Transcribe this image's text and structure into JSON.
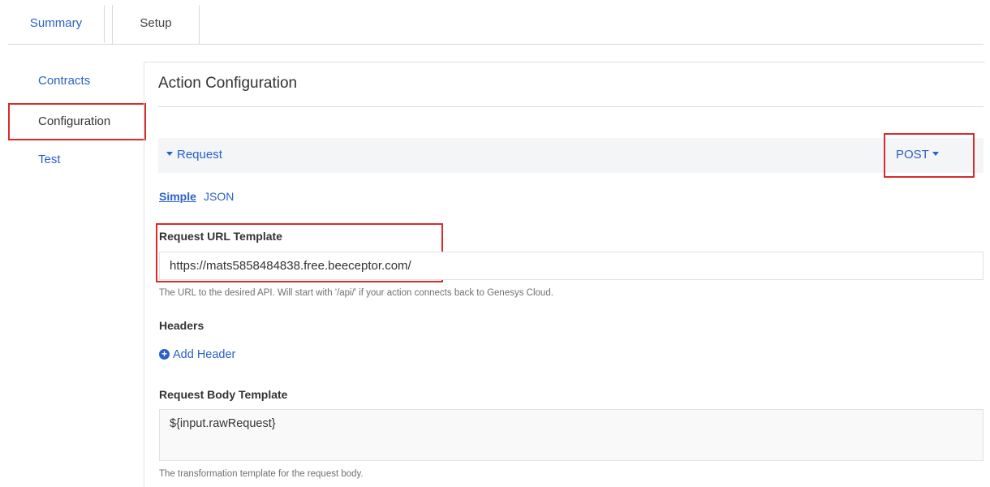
{
  "tabs": [
    {
      "label": "Summary"
    },
    {
      "label": "Setup"
    }
  ],
  "sidebar": {
    "items": [
      {
        "label": "Contracts"
      },
      {
        "label": "Configuration"
      },
      {
        "label": "Test"
      }
    ]
  },
  "main": {
    "title": "Action Configuration",
    "request_toggle": "Request",
    "method": "POST",
    "modes": {
      "simple": "Simple",
      "json": "JSON"
    },
    "url_label": "Request URL Template",
    "url_value": "https://mats5858484838.free.beeceptor.com/",
    "url_help": "The URL to the desired API. Will start with '/api/' if your action connects back to Genesys Cloud.",
    "headers_label": "Headers",
    "add_header": "Add Header",
    "body_label": "Request Body Template",
    "body_value": "${input.rawRequest}",
    "body_help": "The transformation template for the request body."
  },
  "colors": {
    "link": "#2a60c8",
    "highlight": "#d92b2b",
    "bar_bg": "#f3f5f7"
  },
  "icons": {
    "request_caret": "caret-down-icon",
    "method_caret": "caret-down-icon",
    "add_header": "plus-circle-icon"
  }
}
